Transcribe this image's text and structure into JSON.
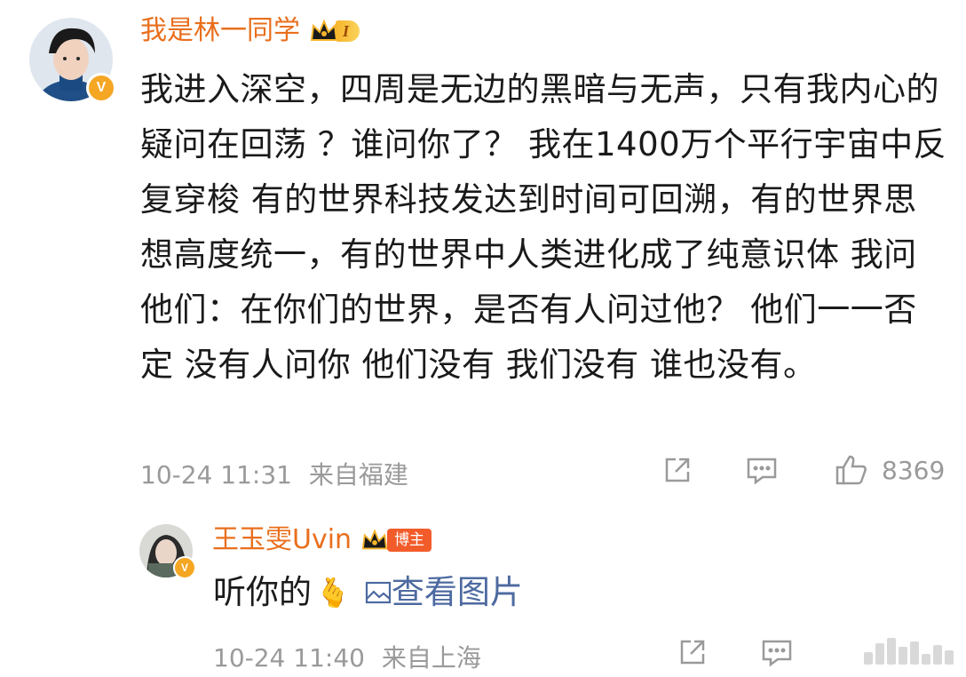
{
  "comment": {
    "username": "我是林一同学",
    "level_badge": "I",
    "content": "我进入深空，四周是无边的黑暗与无声，只有我内心的疑问在回荡 ？谁问你了？ 我在1400万个平行宇宙中反复穿梭 有的世界科技发达到时间可回溯，有的世界思想高度统一，有的世界中人类进化成了纯意识体 我问他们：在你们的世界，是否有人问过他？ 他们一一否定 没有人问你 他们没有 我们没有 谁也没有。",
    "timestamp": "10-24 11:31",
    "location": "来自福建",
    "like_count": "8369"
  },
  "reply": {
    "username": "王玉雯Uvin",
    "author_badge": "博主",
    "text": "听你的",
    "emoji": "🫰",
    "image_link": "查看图片",
    "timestamp": "10-24 11:40",
    "location": "来自上海"
  },
  "colors": {
    "username": "#e96f1d",
    "meta": "#9a9a9a",
    "link": "#4d6aa0",
    "badge_orange": "#f25c2b",
    "verified": "#f5a623"
  },
  "icons": [
    "crown-icon",
    "verified-badge-icon",
    "share-icon",
    "comment-icon",
    "like-icon",
    "image-icon",
    "watermark-logo-icon"
  ]
}
